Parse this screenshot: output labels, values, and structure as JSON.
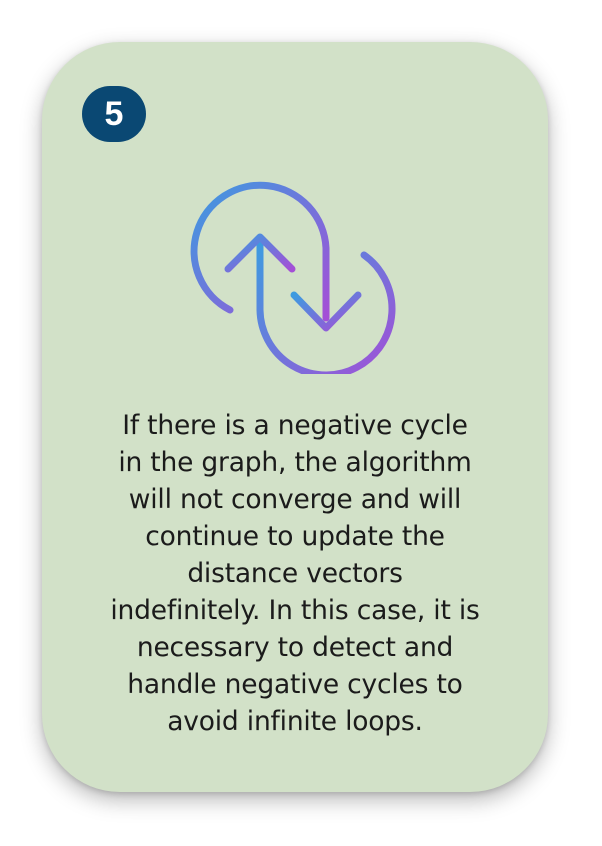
{
  "card": {
    "step_number": "5",
    "icon": "cycle-arrows-icon",
    "description_lines": [
      "If there is a negative cycle",
      "in the graph, the algorithm",
      "will not converge and will",
      "continue to update the",
      "distance vectors",
      "indefinitely. In this case, it is",
      "necessary to detect and",
      "handle negative cycles to",
      "avoid infinite loops."
    ]
  },
  "colors": {
    "card_background": "#d2e1c8",
    "badge_background": "#0a4873",
    "icon_gradient_start": "#3d9be0",
    "icon_gradient_end": "#a44fd6",
    "text": "#1b1b1b"
  }
}
